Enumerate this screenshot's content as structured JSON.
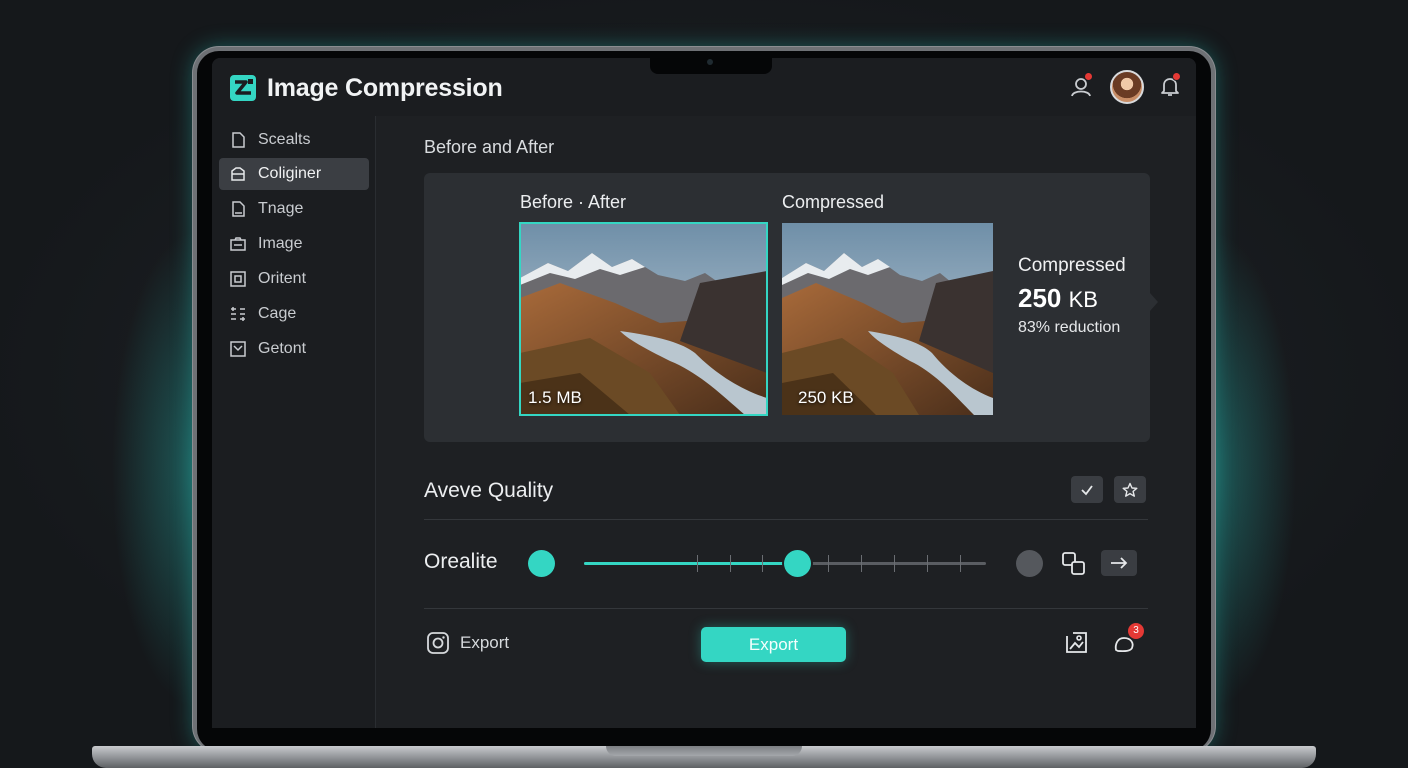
{
  "app": {
    "title": "Image Compression"
  },
  "header": {
    "avatar_alt": "user avatar"
  },
  "sidebar": {
    "items": [
      {
        "label": "Scealts",
        "icon": "document-icon",
        "active": false
      },
      {
        "label": "Coliginer",
        "icon": "folder-icon",
        "active": true
      },
      {
        "label": "Tnage",
        "icon": "file-image-icon",
        "active": false
      },
      {
        "label": "Image",
        "icon": "image-icon",
        "active": false
      },
      {
        "label": "Oritent",
        "icon": "crop-icon",
        "active": false
      },
      {
        "label": "Cage",
        "icon": "grid-icon",
        "active": false
      },
      {
        "label": "Getont",
        "icon": "check-box-icon",
        "active": false
      }
    ]
  },
  "preview": {
    "section_title": "Before and After",
    "before": {
      "label": "Before · After",
      "size": "1.5 MB"
    },
    "after": {
      "label": "Compressed",
      "size": "250 KB"
    },
    "stats": {
      "title": "Compressed",
      "value": "250",
      "unit": "KB",
      "reduction": "83% reduction"
    }
  },
  "quality": {
    "title": "Aveve Quality",
    "slider_label": "Orealite",
    "slider_value_fraction": 0.53,
    "ticks": 10
  },
  "footer": {
    "export_link": "Export",
    "export_button": "Export",
    "notification_count": "3"
  },
  "colors": {
    "accent": "#34d6c3",
    "notification": "#e53935",
    "background": "#1e2023"
  }
}
